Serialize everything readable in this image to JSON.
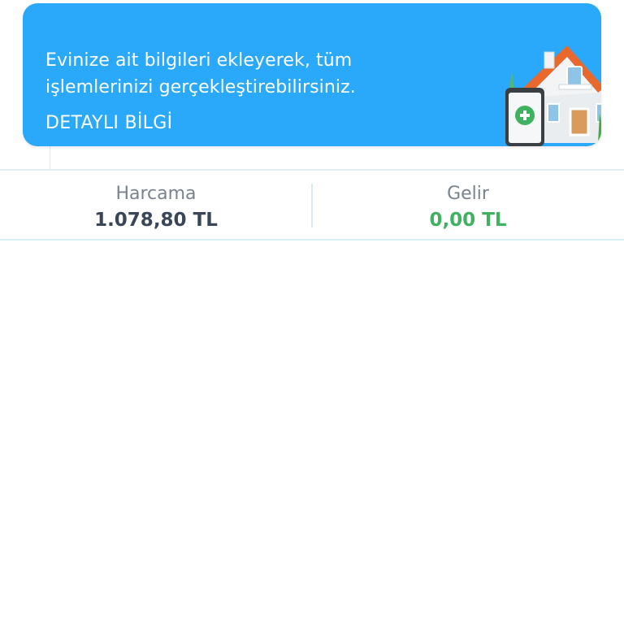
{
  "promo": {
    "message": "Evinize ait bilgileri ekleyerek, tüm işlemlerinizi gerçekleştirebilirsiniz.",
    "link_label": "DETAYLI BİLGİ",
    "illustration_icon": "house-with-add-phone-icon",
    "background_color": "#2aa9fa"
  },
  "summary": {
    "expense_label": "Harcama",
    "expense_value": "1.078,80 TL",
    "income_label": "Gelir",
    "income_value": "0,00 TL",
    "income_color": "#3fb160"
  }
}
